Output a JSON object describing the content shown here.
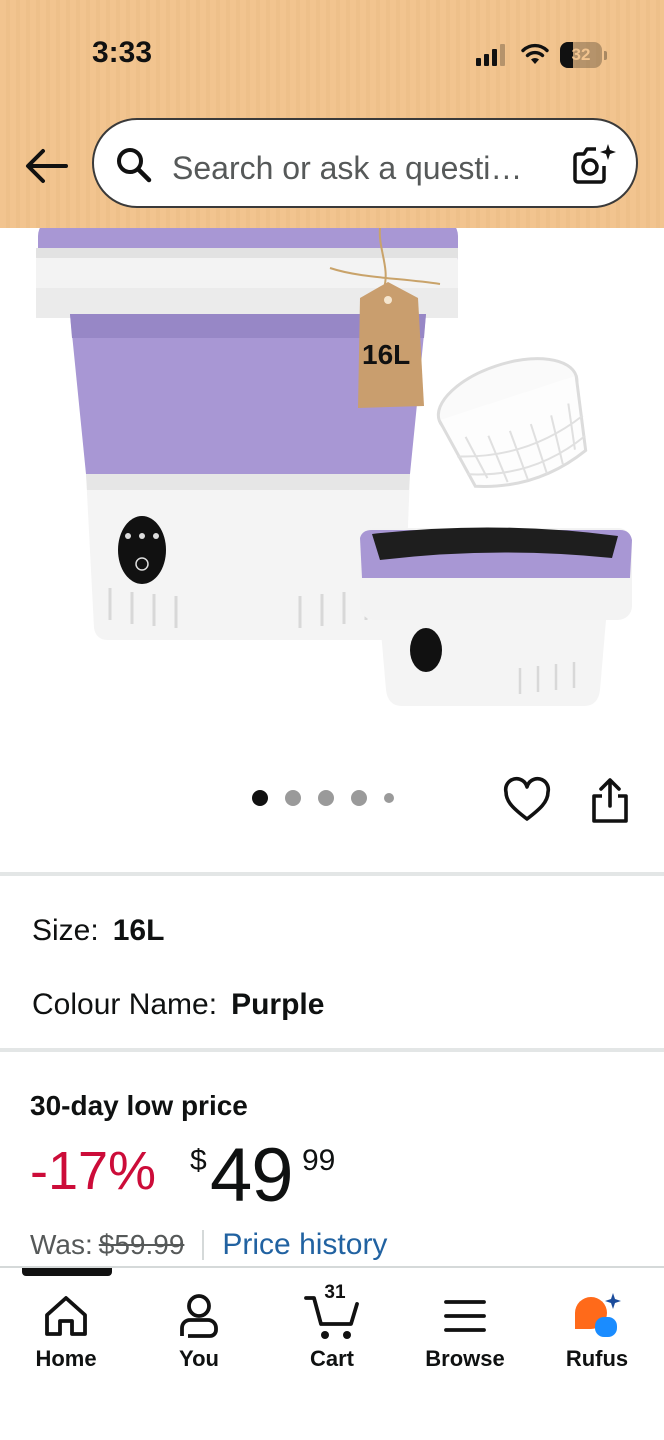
{
  "status_bar": {
    "time": "3:33",
    "battery_percent": "32",
    "battery_level": 0.32
  },
  "header": {
    "back_icon": "arrow-left-icon",
    "search_placeholder": "Search or ask a questi…",
    "search_icon": "search-icon",
    "camera_icon": "camera-sparkle-icon"
  },
  "product": {
    "tag_text": "16L",
    "carousel": {
      "total": 5,
      "active": 1
    },
    "actions": [
      "heart-icon",
      "share-icon"
    ]
  },
  "variations": {
    "size_label": "Size:",
    "size_value": "16L",
    "colour_label": "Colour Name:",
    "colour_value": "Purple"
  },
  "pricing": {
    "deal_badge": "30-day low price",
    "discount": "-17%",
    "currency_symbol": "$",
    "price_whole": "49",
    "price_fraction": "99",
    "was_label": "Was:",
    "was_price": "$59.99",
    "price_history_link": "Price history"
  },
  "bottom_nav": {
    "active_tab": "Home",
    "items": [
      {
        "label": "Home",
        "icon": "home-icon"
      },
      {
        "label": "You",
        "icon": "person-icon"
      },
      {
        "label": "Cart",
        "icon": "cart-icon",
        "count": "31"
      },
      {
        "label": "Browse",
        "icon": "menu-icon"
      },
      {
        "label": "Rufus",
        "icon": "rufus-icon"
      }
    ]
  },
  "colors": {
    "header_bg": "#f2c48f",
    "discount_red": "#cc0c39",
    "link_blue": "#2162a1",
    "product_purple": "#a897d4"
  }
}
